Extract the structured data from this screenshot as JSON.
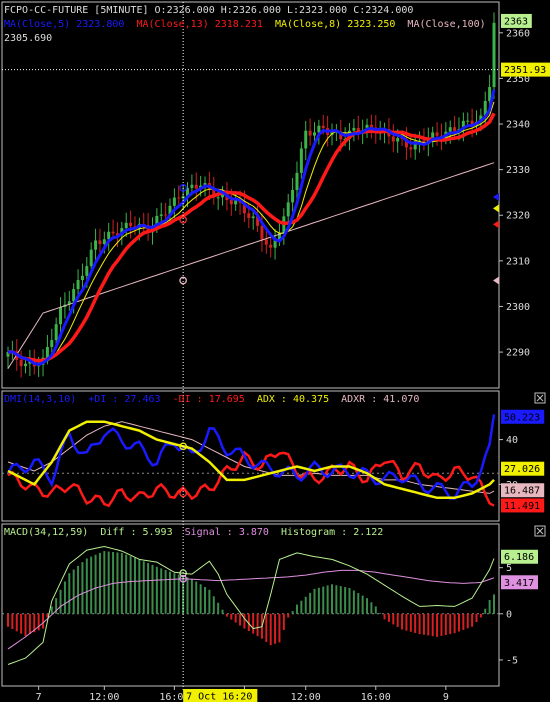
{
  "chart_data": [
    {
      "type": "candlestick",
      "title": "FCPO-CC-FUTURE [5MINUTE]",
      "ohlc_label": "O:2326.000 H:2326.000 L:2323.000 C:2324.000",
      "header_value": "2305.690",
      "ylim": [
        2283,
        2365
      ],
      "yticks": [
        2290,
        2300,
        2310,
        2320,
        2330,
        2340,
        2350,
        2360
      ],
      "series": [
        {
          "name": "MA(Close,5)",
          "value": "2323.800",
          "color": "#1a1aff"
        },
        {
          "name": "MA(Close,13)",
          "value": "2318.231",
          "color": "#ff1a1a"
        },
        {
          "name": "MA(Close,8)",
          "value": "2323.250",
          "color": "#f0f000"
        },
        {
          "name": "MA(Close,100)",
          "value": "",
          "color": "#e8b8c0"
        }
      ],
      "last_price_tag": "2363",
      "cursor_price_tag": "2351.93",
      "close_anchors": [
        [
          0,
          2290
        ],
        [
          4,
          2287
        ],
        [
          8,
          2288
        ],
        [
          12,
          2299
        ],
        [
          16,
          2305
        ],
        [
          20,
          2314
        ],
        [
          24,
          2316
        ],
        [
          28,
          2318
        ],
        [
          32,
          2317
        ],
        [
          36,
          2321
        ],
        [
          40,
          2325
        ],
        [
          44,
          2327
        ],
        [
          48,
          2324
        ],
        [
          52,
          2323
        ],
        [
          56,
          2319
        ],
        [
          60,
          2312
        ],
        [
          64,
          2322
        ],
        [
          68,
          2338
        ],
        [
          72,
          2339
        ],
        [
          76,
          2337
        ],
        [
          80,
          2339
        ],
        [
          84,
          2339
        ],
        [
          88,
          2337
        ],
        [
          92,
          2335
        ],
        [
          96,
          2337
        ],
        [
          100,
          2338
        ],
        [
          104,
          2340
        ],
        [
          108,
          2341
        ],
        [
          110,
          2349
        ],
        [
          111,
          2362
        ]
      ]
    },
    {
      "type": "line",
      "title": "DMI(14,3,10)",
      "series": [
        {
          "name": "+DI",
          "value": "27.463",
          "color": "#1a1aff"
        },
        {
          "name": "-DI",
          "value": "17.695",
          "color": "#ff1a1a"
        },
        {
          "name": "ADX",
          "value": "40.375",
          "color": "#f0f000"
        },
        {
          "name": "ADXR",
          "value": "41.070",
          "color": "#e8b8c0"
        }
      ],
      "ylim": [
        5,
        55
      ],
      "yticks": [
        20,
        40
      ],
      "tags": [
        "50.223",
        "27.026",
        "16.487",
        "11.491"
      ],
      "plus_di": [
        [
          0,
          25
        ],
        [
          6,
          30
        ],
        [
          10,
          23
        ],
        [
          14,
          42
        ],
        [
          18,
          32
        ],
        [
          22,
          44
        ],
        [
          26,
          40
        ],
        [
          30,
          36
        ],
        [
          34,
          30
        ],
        [
          38,
          40
        ],
        [
          42,
          32
        ],
        [
          46,
          44
        ],
        [
          50,
          36
        ],
        [
          54,
          32
        ],
        [
          58,
          28
        ],
        [
          62,
          26
        ],
        [
          66,
          24
        ],
        [
          70,
          27
        ],
        [
          74,
          26
        ],
        [
          78,
          26
        ],
        [
          82,
          24
        ],
        [
          86,
          22
        ],
        [
          90,
          24
        ],
        [
          94,
          20
        ],
        [
          98,
          18
        ],
        [
          102,
          16
        ],
        [
          106,
          20
        ],
        [
          110,
          35
        ],
        [
          111,
          50
        ]
      ],
      "minus_di": [
        [
          0,
          24
        ],
        [
          6,
          18
        ],
        [
          10,
          16
        ],
        [
          14,
          20
        ],
        [
          18,
          14
        ],
        [
          22,
          12
        ],
        [
          26,
          16
        ],
        [
          30,
          14
        ],
        [
          34,
          18
        ],
        [
          38,
          16
        ],
        [
          42,
          16
        ],
        [
          46,
          18
        ],
        [
          50,
          26
        ],
        [
          54,
          32
        ],
        [
          58,
          28
        ],
        [
          62,
          36
        ],
        [
          66,
          26
        ],
        [
          70,
          22
        ],
        [
          74,
          26
        ],
        [
          78,
          28
        ],
        [
          82,
          22
        ],
        [
          86,
          32
        ],
        [
          90,
          24
        ],
        [
          94,
          28
        ],
        [
          98,
          22
        ],
        [
          102,
          26
        ],
        [
          106,
          24
        ],
        [
          110,
          14
        ],
        [
          111,
          11
        ]
      ],
      "adx": [
        [
          0,
          26
        ],
        [
          6,
          20
        ],
        [
          10,
          30
        ],
        [
          14,
          44
        ],
        [
          18,
          48
        ],
        [
          22,
          48
        ],
        [
          26,
          46
        ],
        [
          30,
          44
        ],
        [
          34,
          40
        ],
        [
          38,
          38
        ],
        [
          42,
          36
        ],
        [
          46,
          30
        ],
        [
          50,
          22
        ],
        [
          54,
          22
        ],
        [
          58,
          24
        ],
        [
          62,
          26
        ],
        [
          66,
          28
        ],
        [
          70,
          26
        ],
        [
          74,
          28
        ],
        [
          78,
          28
        ],
        [
          82,
          25
        ],
        [
          86,
          20
        ],
        [
          90,
          18
        ],
        [
          94,
          16
        ],
        [
          98,
          14
        ],
        [
          102,
          14
        ],
        [
          106,
          16
        ],
        [
          110,
          20
        ],
        [
          111,
          22
        ]
      ],
      "adxr": [
        [
          0,
          30
        ],
        [
          6,
          26
        ],
        [
          10,
          30
        ],
        [
          14,
          36
        ],
        [
          18,
          42
        ],
        [
          22,
          46
        ],
        [
          26,
          48
        ],
        [
          30,
          46
        ],
        [
          34,
          44
        ],
        [
          38,
          42
        ],
        [
          42,
          40
        ],
        [
          46,
          36
        ],
        [
          50,
          32
        ],
        [
          54,
          28
        ],
        [
          58,
          26
        ],
        [
          62,
          24
        ],
        [
          66,
          24
        ],
        [
          70,
          25
        ],
        [
          74,
          24
        ],
        [
          78,
          24
        ],
        [
          82,
          24
        ],
        [
          86,
          22
        ],
        [
          90,
          22
        ],
        [
          94,
          20
        ],
        [
          98,
          19
        ],
        [
          102,
          18
        ],
        [
          106,
          17
        ],
        [
          110,
          16
        ],
        [
          111,
          17
        ]
      ]
    },
    {
      "type": "bar",
      "title": "MACD(34,12,59)",
      "series": [
        {
          "name": "Diff",
          "value": "5.993",
          "color": "#b8f090"
        },
        {
          "name": "Signal",
          "value": "3.870",
          "color": "#e090e0"
        },
        {
          "name": "Histogram",
          "value": "2.122",
          "color": "#3c8c4c"
        }
      ],
      "ylim": [
        -7.5,
        8
      ],
      "yticks": [
        -5,
        0,
        5
      ],
      "tags": [
        "6.186",
        "3.417"
      ],
      "histogram": [
        [
          0,
          -1.4
        ],
        [
          4,
          -2.4
        ],
        [
          8,
          -1.6
        ],
        [
          10,
          0.8
        ],
        [
          14,
          4.4
        ],
        [
          18,
          6
        ],
        [
          22,
          6.8
        ],
        [
          26,
          6.6
        ],
        [
          30,
          5.9
        ],
        [
          34,
          5.1
        ],
        [
          38,
          4.4
        ],
        [
          42,
          3.8
        ],
        [
          46,
          2.6
        ],
        [
          48,
          1.2
        ],
        [
          50,
          -0.3
        ],
        [
          54,
          -1.6
        ],
        [
          58,
          -2.7
        ],
        [
          60,
          -3.4
        ],
        [
          62,
          -3.1
        ],
        [
          64,
          -0.4
        ],
        [
          66,
          1
        ],
        [
          70,
          2.7
        ],
        [
          74,
          3.2
        ],
        [
          78,
          2.8
        ],
        [
          82,
          1.7
        ],
        [
          84,
          0.8
        ],
        [
          86,
          -0.6
        ],
        [
          90,
          -1.7
        ],
        [
          94,
          -2.2
        ],
        [
          98,
          -2.5
        ],
        [
          102,
          -2.1
        ],
        [
          106,
          -1.4
        ],
        [
          108,
          -0.4
        ],
        [
          110,
          1.5
        ],
        [
          111,
          2.1
        ]
      ],
      "diff": [
        [
          0,
          -5.5
        ],
        [
          4,
          -4.8
        ],
        [
          8,
          -3.1
        ],
        [
          10,
          1.4
        ],
        [
          14,
          5.4
        ],
        [
          18,
          6.9
        ],
        [
          22,
          7.3
        ],
        [
          26,
          6.8
        ],
        [
          30,
          5.9
        ],
        [
          34,
          5.6
        ],
        [
          38,
          4.5
        ],
        [
          42,
          4.3
        ],
        [
          46,
          5.7
        ],
        [
          48,
          4.3
        ],
        [
          50,
          2.1
        ],
        [
          54,
          -0.5
        ],
        [
          56,
          -1.6
        ],
        [
          58,
          -1.4
        ],
        [
          60,
          2.1
        ],
        [
          62,
          5.9
        ],
        [
          66,
          6.6
        ],
        [
          70,
          6.2
        ],
        [
          74,
          5.9
        ],
        [
          78,
          5.2
        ],
        [
          82,
          4.3
        ],
        [
          86,
          3.1
        ],
        [
          90,
          1.9
        ],
        [
          94,
          0.8
        ],
        [
          98,
          0.9
        ],
        [
          102,
          0.8
        ],
        [
          106,
          1.7
        ],
        [
          110,
          4.8
        ],
        [
          111,
          6
        ]
      ],
      "signal": [
        [
          0,
          -3.8
        ],
        [
          4,
          -2.5
        ],
        [
          8,
          -1
        ],
        [
          12,
          0.8
        ],
        [
          16,
          2
        ],
        [
          20,
          2.8
        ],
        [
          24,
          3.3
        ],
        [
          28,
          3.5
        ],
        [
          32,
          3.6
        ],
        [
          36,
          3.7
        ],
        [
          40,
          3.8
        ],
        [
          44,
          3.7
        ],
        [
          48,
          3.6
        ],
        [
          52,
          3.7
        ],
        [
          56,
          3.8
        ],
        [
          60,
          3.9
        ],
        [
          64,
          4.0
        ],
        [
          68,
          4.2
        ],
        [
          72,
          4.5
        ],
        [
          76,
          4.7
        ],
        [
          80,
          4.7
        ],
        [
          84,
          4.5
        ],
        [
          88,
          4.2
        ],
        [
          92,
          3.9
        ],
        [
          96,
          3.6
        ],
        [
          100,
          3.4
        ],
        [
          104,
          3.3
        ],
        [
          108,
          3.4
        ],
        [
          111,
          3.9
        ]
      ]
    }
  ],
  "x_axis": {
    "bars": 112,
    "ticks": [
      {
        "bar": 7,
        "label": "7"
      },
      {
        "bar": 22,
        "label": "12:00"
      },
      {
        "bar": 38,
        "label": "16:00"
      },
      {
        "bar": 54,
        "label": "8"
      },
      {
        "bar": 68,
        "label": "12:00"
      },
      {
        "bar": 84,
        "label": "16:00"
      },
      {
        "bar": 100,
        "label": "9"
      }
    ],
    "cursor_bar": 40,
    "cursor_label": "7 Oct 16:20"
  }
}
